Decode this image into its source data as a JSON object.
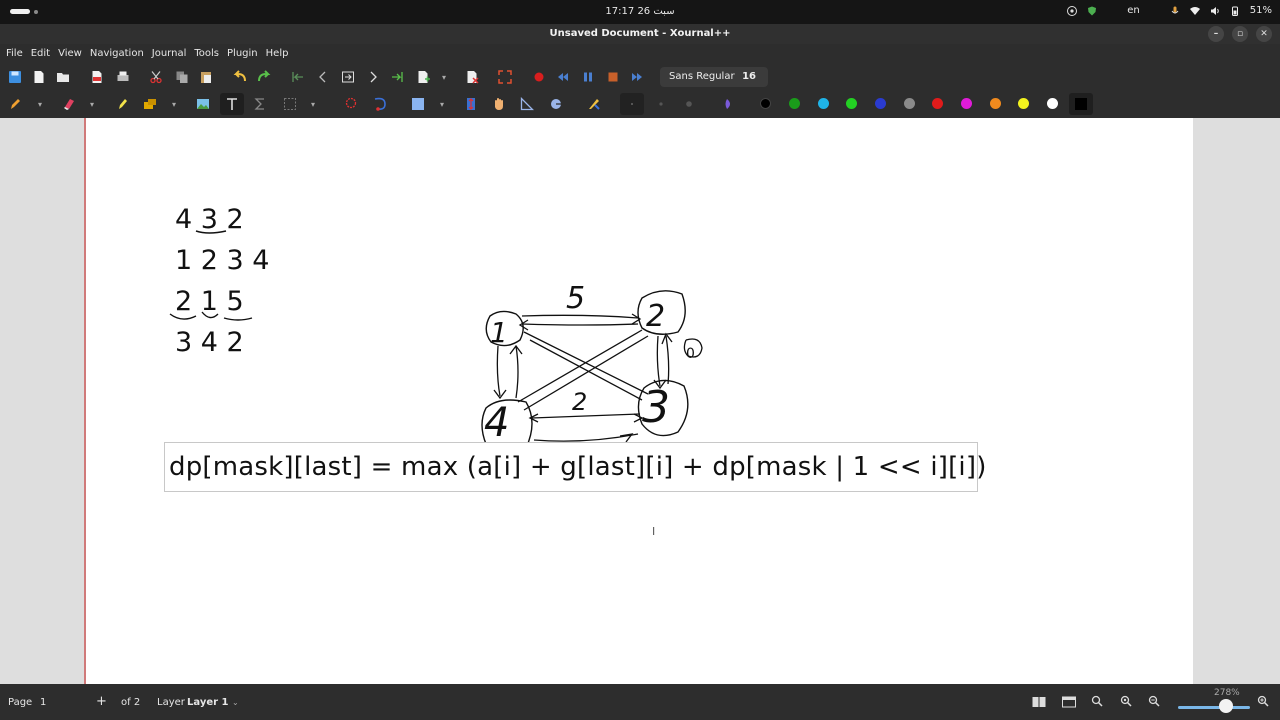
{
  "topbar": {
    "clock": "سبت 26  17:17",
    "language": "en",
    "battery": "51%"
  },
  "window": {
    "title": "Unsaved Document - Xournal++"
  },
  "menubar": {
    "items": [
      "File",
      "Edit",
      "View",
      "Navigation",
      "Journal",
      "Tools",
      "Plugin",
      "Help"
    ]
  },
  "toolbar": {
    "font_name": "Sans Regular",
    "font_size": "16",
    "colors": [
      "#000000",
      "#1a9c1a",
      "#1fb4e8",
      "#23d023",
      "#2a3bd0",
      "#8a8a8a",
      "#e01b1b",
      "#e01bd8",
      "#f08a1e",
      "#f2f21e",
      "#ffffff",
      "#000000"
    ]
  },
  "canvas": {
    "handwriting": {
      "line1": "4 3 2",
      "line2": "1 2 3 4",
      "line3": "2 1 5",
      "line4": "3 4 2"
    },
    "graph": {
      "node_labels": [
        "1",
        "2",
        "3",
        "4"
      ],
      "edge_labels": [
        "5",
        "0",
        "2"
      ]
    },
    "formula": "dp[mask][last] = max (a[i] + g[last][i] + dp[mask | 1 << i][i])"
  },
  "statusbar": {
    "page_label": "Page",
    "page_value": "1",
    "add": "+",
    "of_pages": "of 2",
    "layer_label": "Layer",
    "layer_value": "Layer 1",
    "zoom": "278%"
  }
}
